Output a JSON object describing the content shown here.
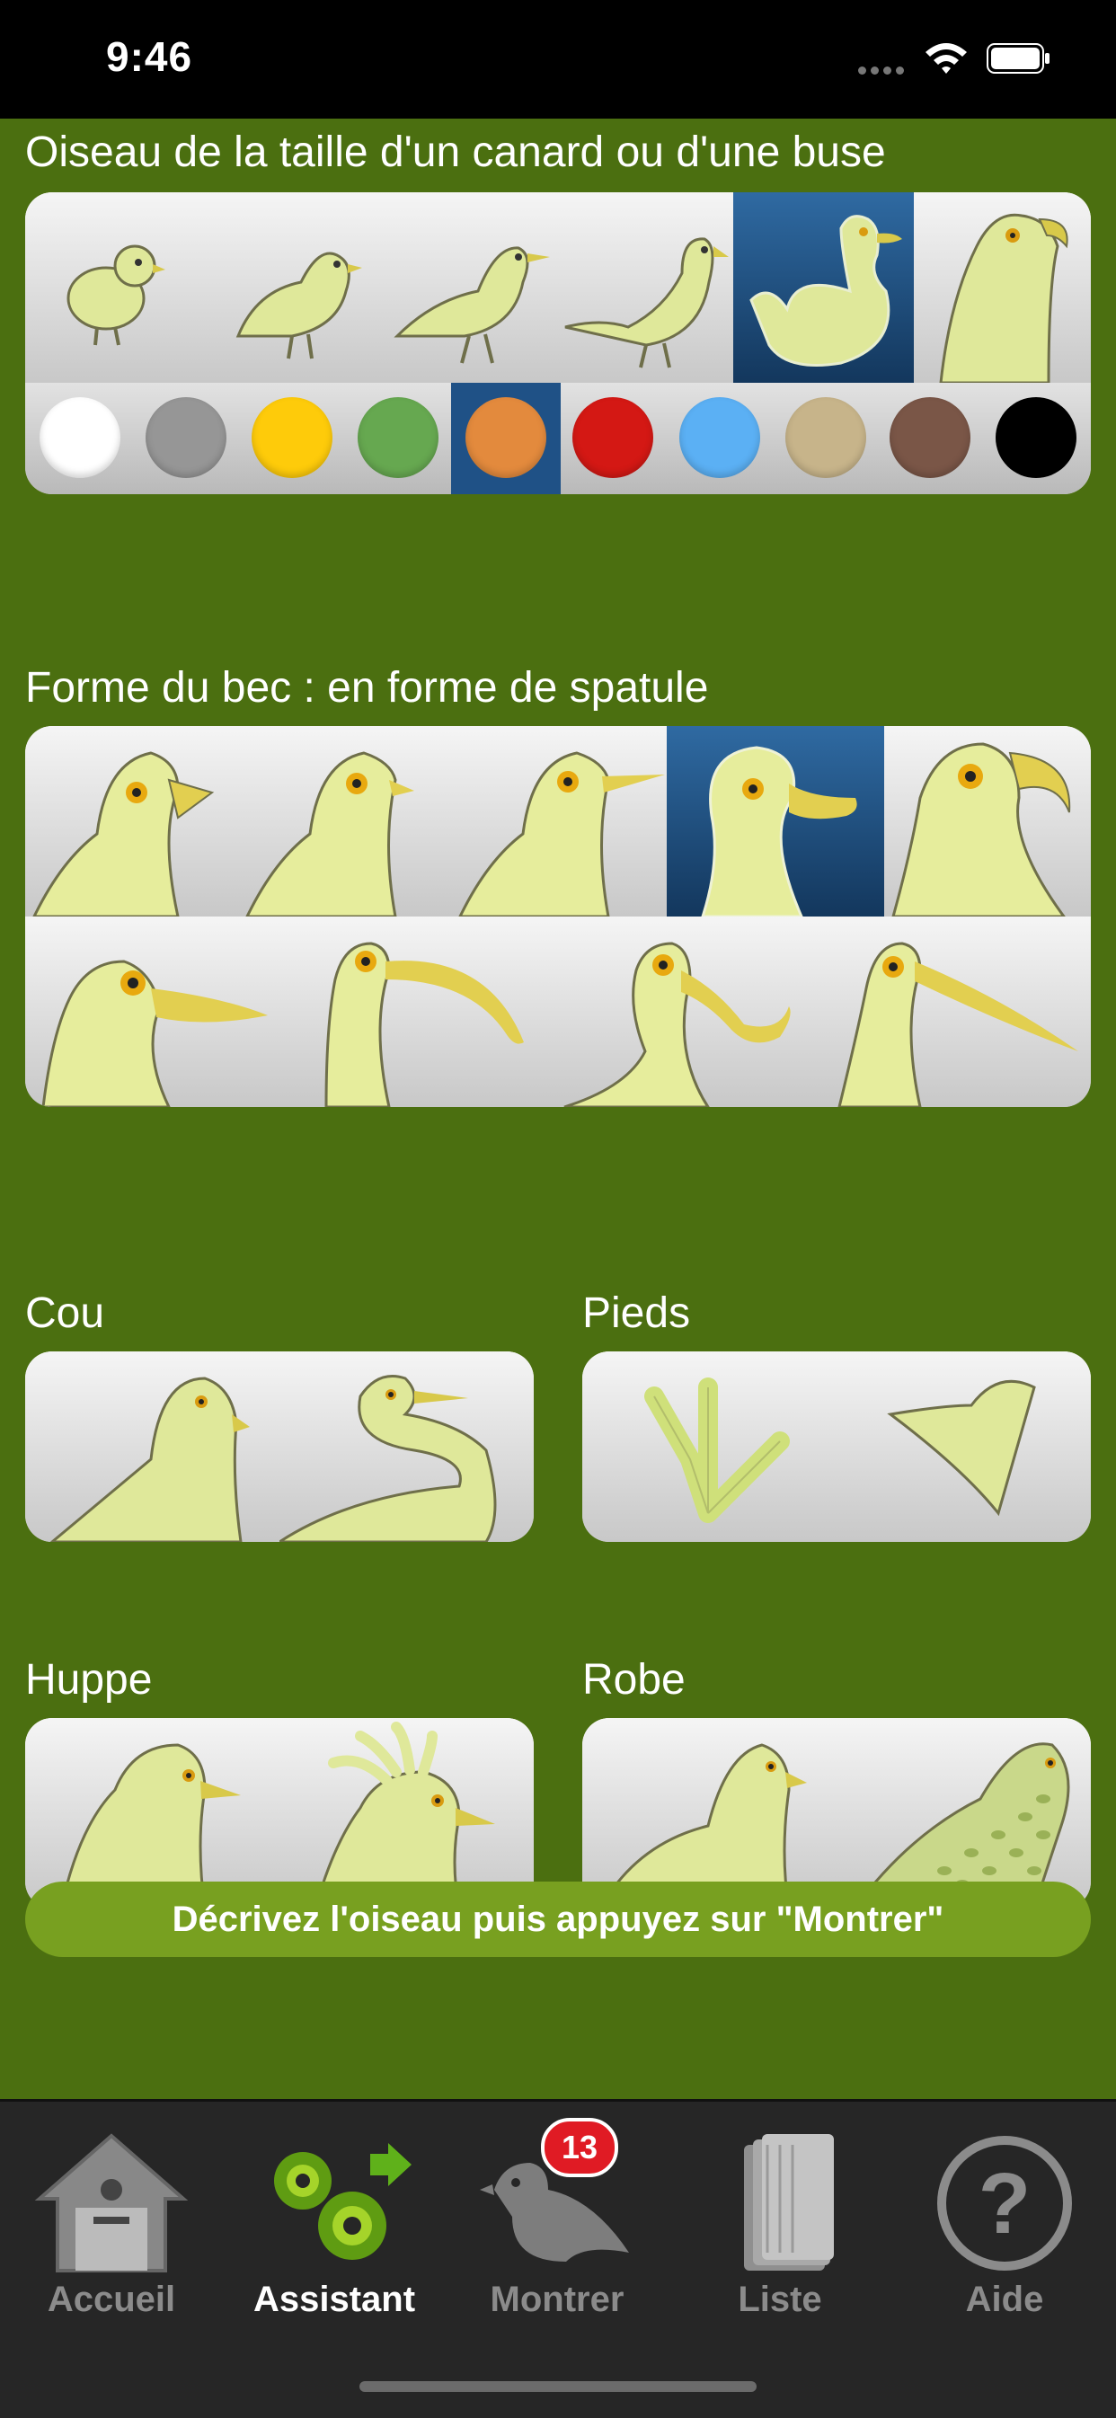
{
  "status_bar": {
    "time": "9:46"
  },
  "sections": {
    "taille": {
      "title": "Oiseau de la taille d'un canard ou d'une buse"
    },
    "bec": {
      "title": "Forme du bec : en forme de spatule"
    },
    "cou": {
      "title": "Cou"
    },
    "pieds": {
      "title": "Pieds"
    },
    "huppe": {
      "title": "Huppe"
    },
    "robe": {
      "title": "Robe"
    }
  },
  "colors": {
    "selected_index": 4,
    "swatches": [
      "#ffffff",
      "#969696",
      "#fecb0a",
      "#66a850",
      "#e38a3d",
      "#d41814",
      "#5bb0f4",
      "#c7b48a",
      "#7a5647",
      "#000000"
    ]
  },
  "cta": {
    "label": "Décrivez l'oiseau puis appuyez sur \"Montrer\""
  },
  "tabbar": {
    "tabs": [
      {
        "label": "Accueil",
        "icon": "house-icon"
      },
      {
        "label": "Assistant",
        "icon": "gears-icon",
        "active": true
      },
      {
        "label": "Montrer",
        "icon": "bird-icon"
      },
      {
        "label": "Liste",
        "icon": "book-icon"
      },
      {
        "label": "Aide",
        "icon": "help-icon"
      }
    ],
    "badge": "13"
  },
  "theme": {
    "background": "#4b6f10",
    "accent": "#78a020",
    "selected_tile": "#1f5186",
    "bird_fill": "#dfe89a"
  }
}
